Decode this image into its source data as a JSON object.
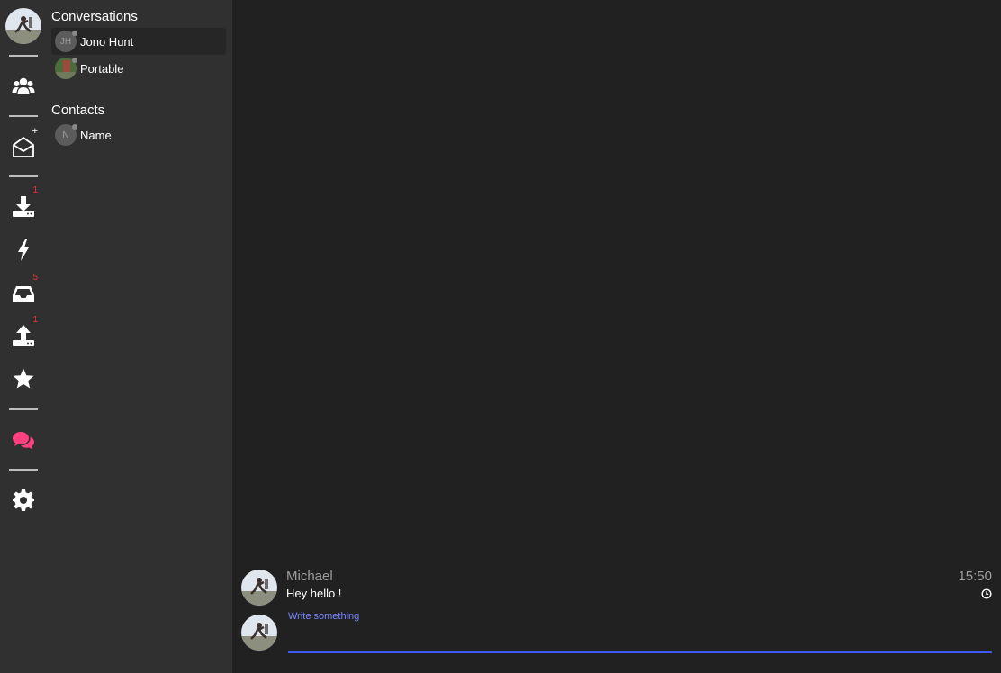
{
  "sidebar": {
    "badges": {
      "download": "1",
      "inbox": "5",
      "upload": "1"
    },
    "compose_plus": "+",
    "active_color": "#ff4081"
  },
  "conversations": {
    "title": "Conversations",
    "items": [
      {
        "initials": "JH",
        "name": "Jono Hunt",
        "active": true
      },
      {
        "initials": "",
        "name": "Portable",
        "active": false
      }
    ]
  },
  "contacts": {
    "title": "Contacts",
    "items": [
      {
        "initials": "N",
        "name": "Name"
      }
    ]
  },
  "chat": {
    "messages": [
      {
        "author": "Michael",
        "time": "15:50",
        "text": "Hey hello !"
      }
    ],
    "compose": {
      "label": "Write something",
      "value": ""
    },
    "accent": "#3d5afe"
  }
}
